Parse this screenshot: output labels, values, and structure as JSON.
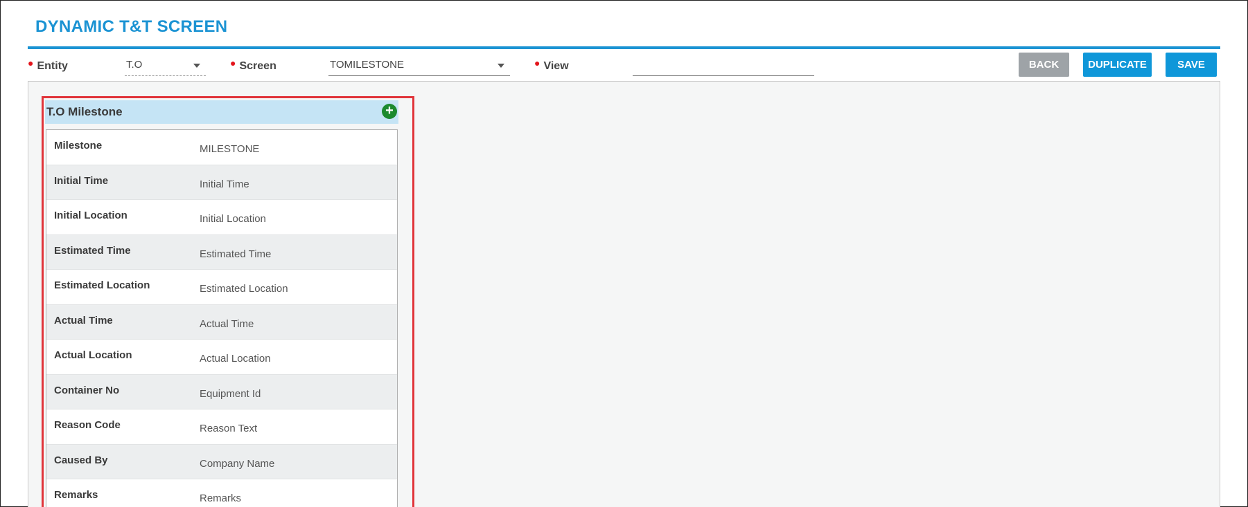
{
  "header": {
    "title": "DYNAMIC T&T SCREEN"
  },
  "filters": {
    "entity": {
      "label": "Entity",
      "value": "T.O"
    },
    "screen": {
      "label": "Screen",
      "value": "TOMILESTONE"
    },
    "view": {
      "label": "View",
      "value": ""
    }
  },
  "toolbar": {
    "back_label": "BACK",
    "duplicate_label": "DUPLICATE",
    "save_label": "SAVE"
  },
  "panel": {
    "title": "T.O Milestone",
    "add_icon": "plus-circle-icon",
    "rows": [
      {
        "key": "Milestone",
        "value": "MILESTONE"
      },
      {
        "key": "Initial Time",
        "value": "Initial Time"
      },
      {
        "key": "Initial Location",
        "value": "Initial Location"
      },
      {
        "key": "Estimated Time",
        "value": "Estimated Time"
      },
      {
        "key": "Estimated Location",
        "value": "Estimated Location"
      },
      {
        "key": "Actual Time",
        "value": "Actual Time"
      },
      {
        "key": "Actual Location",
        "value": "Actual Location"
      },
      {
        "key": "Container No",
        "value": "Equipment Id"
      },
      {
        "key": "Reason Code",
        "value": "Reason Text"
      },
      {
        "key": "Caused By",
        "value": "Company Name"
      },
      {
        "key": "Remarks",
        "value": "Remarks"
      }
    ]
  },
  "colors": {
    "accent": "#1b93d3",
    "required": "#e3141b",
    "add": "#1c8a2e",
    "highlight": "#e0343a"
  }
}
